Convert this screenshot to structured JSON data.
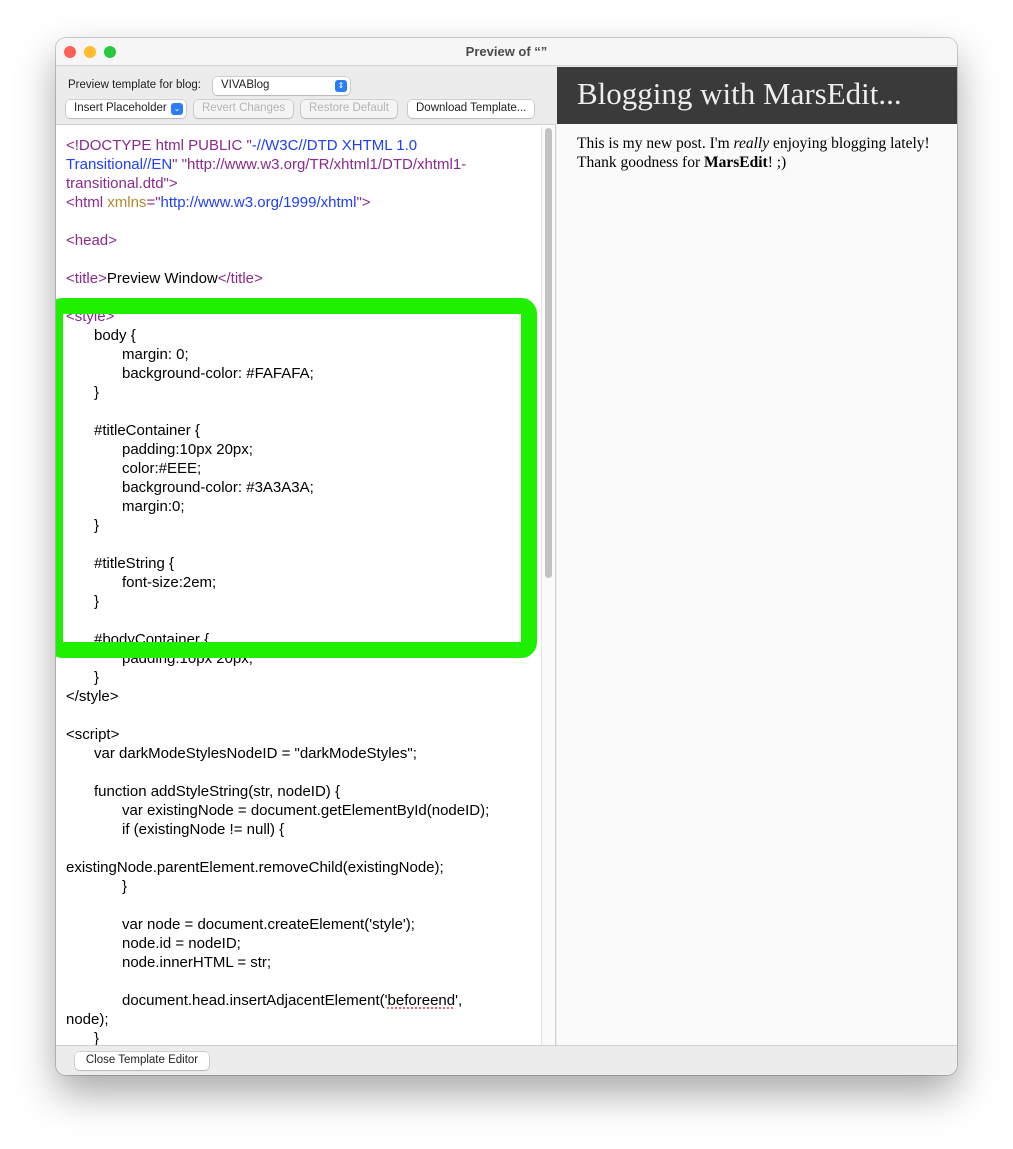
{
  "window": {
    "title": "Preview of “”"
  },
  "toolbar": {
    "blog_label": "Preview template for blog:",
    "blog_value": "VIVABlog",
    "insert_placeholder": "Insert Placeholder",
    "revert": "Revert Changes",
    "restore": "Restore Default",
    "download": "Download Template..."
  },
  "colors": {
    "tag": "#8b2a8b",
    "string": "#1f3ef5",
    "attr": "#b58a2c",
    "highlight": "#1ef000",
    "title_bg": "#3a3a3a"
  },
  "code_lines": [
    {
      "i": 0,
      "p": [
        [
          "<!DOCTYPE html PUBLIC \"",
          "p"
        ],
        [
          "-//W3C//DTD XHTML 1.0",
          "b"
        ]
      ]
    },
    {
      "i": 0,
      "p": [
        [
          "Transitional//EN",
          "b"
        ],
        [
          "\" \"http://www.w3.org/TR/xhtml1/DTD/xhtml1-",
          "p"
        ]
      ]
    },
    {
      "i": 0,
      "p": [
        [
          "transitional.dtd\">",
          "p"
        ]
      ]
    },
    {
      "i": 0,
      "p": [
        [
          "<html ",
          "p"
        ],
        [
          "xmlns",
          "g"
        ],
        [
          "=\"",
          "p"
        ],
        [
          "http://www.w3.org/1999/xhtml",
          "b"
        ],
        [
          "\">",
          "p"
        ]
      ]
    },
    {
      "i": 0,
      "p": []
    },
    {
      "i": 0,
      "p": [
        [
          "<head>",
          "p"
        ]
      ]
    },
    {
      "i": 0,
      "p": []
    },
    {
      "i": 0,
      "p": [
        [
          "<title>",
          "p"
        ],
        [
          "Preview Window",
          "k"
        ],
        [
          "</title>",
          "p"
        ]
      ]
    },
    {
      "i": 0,
      "p": []
    },
    {
      "i": 0,
      "p": [
        [
          "<style>",
          "p"
        ]
      ]
    },
    {
      "i": 1,
      "p": [
        [
          "body {",
          "k"
        ]
      ]
    },
    {
      "i": 2,
      "p": [
        [
          "margin: 0;",
          "k"
        ]
      ]
    },
    {
      "i": 2,
      "p": [
        [
          "background-color: #FAFAFA;",
          "k"
        ]
      ]
    },
    {
      "i": 1,
      "p": [
        [
          "}",
          "k"
        ]
      ]
    },
    {
      "i": 0,
      "p": []
    },
    {
      "i": 1,
      "p": [
        [
          "#titleContainer {",
          "k"
        ]
      ]
    },
    {
      "i": 2,
      "p": [
        [
          "padding:10px 20px;",
          "k"
        ]
      ]
    },
    {
      "i": 2,
      "p": [
        [
          "color:#EEE;",
          "k"
        ]
      ]
    },
    {
      "i": 2,
      "p": [
        [
          "background-color: #3A3A3A;",
          "k"
        ]
      ]
    },
    {
      "i": 2,
      "p": [
        [
          "margin:0;",
          "k"
        ]
      ]
    },
    {
      "i": 1,
      "p": [
        [
          "}",
          "k"
        ]
      ]
    },
    {
      "i": 0,
      "p": []
    },
    {
      "i": 1,
      "p": [
        [
          "#titleString {",
          "k"
        ]
      ]
    },
    {
      "i": 2,
      "p": [
        [
          "font-size:2em;",
          "k"
        ]
      ]
    },
    {
      "i": 1,
      "p": [
        [
          "}",
          "k"
        ]
      ]
    },
    {
      "i": 0,
      "p": []
    },
    {
      "i": 1,
      "p": [
        [
          "#bodyContainer {",
          "k"
        ]
      ]
    },
    {
      "i": 2,
      "p": [
        [
          "padding:10px 20px;",
          "k"
        ]
      ]
    },
    {
      "i": 1,
      "p": [
        [
          "}",
          "k"
        ]
      ]
    },
    {
      "i": 0,
      "p": [
        [
          "</style>",
          "k"
        ]
      ]
    },
    {
      "i": 0,
      "p": []
    },
    {
      "i": 0,
      "p": [
        [
          "<script>",
          "k"
        ]
      ]
    },
    {
      "i": 1,
      "p": [
        [
          "var darkModeStylesNodeID = \"darkModeStyles\";",
          "k"
        ]
      ]
    },
    {
      "i": 0,
      "p": []
    },
    {
      "i": 1,
      "p": [
        [
          "function addStyleString(str, nodeID) {",
          "k"
        ]
      ]
    },
    {
      "i": 2,
      "p": [
        [
          "var existingNode = document.getElementById(nodeID);",
          "k"
        ]
      ]
    },
    {
      "i": 2,
      "p": [
        [
          "if (existingNode != null) {",
          "k"
        ]
      ]
    },
    {
      "i": 0,
      "p": []
    },
    {
      "i": 0,
      "p": [
        [
          "existingNode.parentElement.removeChild(existingNode);",
          "k"
        ]
      ]
    },
    {
      "i": 2,
      "p": [
        [
          "}",
          "k"
        ]
      ]
    },
    {
      "i": 0,
      "p": []
    },
    {
      "i": 2,
      "p": [
        [
          "var node = document.createElement('style');",
          "k"
        ]
      ]
    },
    {
      "i": 2,
      "p": [
        [
          "node.id = nodeID;",
          "k"
        ]
      ]
    },
    {
      "i": 2,
      "p": [
        [
          "node.innerHTML = str;",
          "k"
        ]
      ]
    },
    {
      "i": 0,
      "p": []
    },
    {
      "i": 2,
      "p": [
        [
          "document.head.insertAdjacentElement('",
          "k"
        ],
        [
          "beforeend",
          "s"
        ],
        [
          "',",
          "k"
        ]
      ]
    },
    {
      "i": 0,
      "p": [
        [
          "node);",
          "k"
        ]
      ]
    },
    {
      "i": 1,
      "p": [
        [
          "}",
          "k"
        ]
      ]
    }
  ],
  "preview": {
    "title": "Blogging with MarsEdit...",
    "body_1": "This is my new post. I'm ",
    "body_em": "really",
    "body_2": " enjoying blogging lately! Thank goodness for ",
    "body_strong": "MarsEdit",
    "body_3": "! ;)"
  },
  "footer": {
    "close": "Close Template Editor"
  }
}
